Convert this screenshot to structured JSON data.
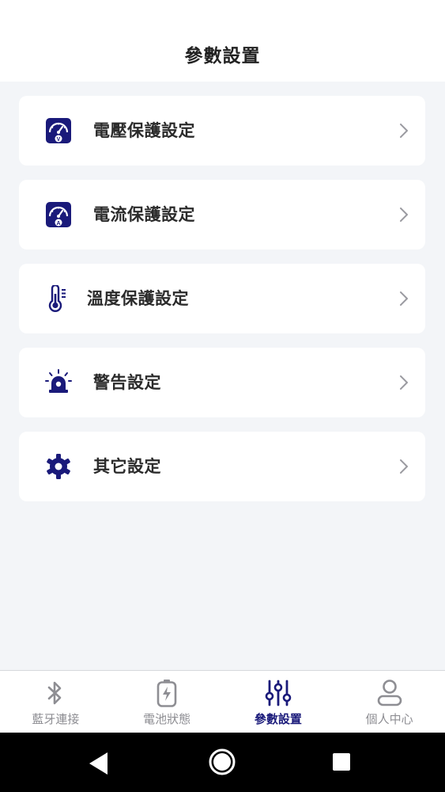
{
  "header": {
    "title": "參數設置"
  },
  "menu": {
    "items": [
      {
        "label": "電壓保護設定",
        "icon": "voltmeter-icon"
      },
      {
        "label": "電流保護設定",
        "icon": "ammeter-icon"
      },
      {
        "label": "溫度保護設定",
        "icon": "thermometer-icon"
      },
      {
        "label": "警告設定",
        "icon": "alarm-light-icon"
      },
      {
        "label": "其它設定",
        "icon": "gear-icon"
      }
    ]
  },
  "tabs": [
    {
      "label": "藍牙連接",
      "icon": "bluetooth-icon",
      "active": false
    },
    {
      "label": "電池狀態",
      "icon": "battery-icon",
      "active": false
    },
    {
      "label": "參數設置",
      "icon": "sliders-icon",
      "active": true
    },
    {
      "label": "個人中心",
      "icon": "user-icon",
      "active": false
    }
  ],
  "colors": {
    "accent": "#1a1a7a",
    "background": "#f3f5f8",
    "inactive": "#8e8e93"
  }
}
